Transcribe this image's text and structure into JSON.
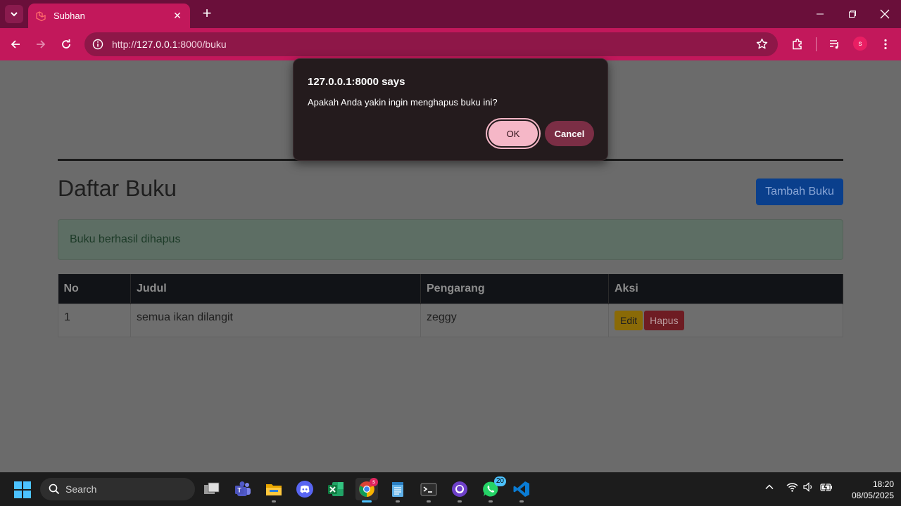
{
  "browser": {
    "tab_title": "Subhan",
    "url_prefix": "http://",
    "url_host": "127.0.0.1",
    "url_suffix": ":8000/buku",
    "profile_initial": "s"
  },
  "page": {
    "title": "Daftar Buku",
    "add_button": "Tambah Buku",
    "alert_message": "Buku berhasil dihapus",
    "table": {
      "headers": [
        "No",
        "Judul",
        "Pengarang",
        "Aksi"
      ],
      "rows": [
        {
          "no": "1",
          "judul": "semua ikan dilangit",
          "pengarang": "zeggy",
          "edit": "Edit",
          "hapus": "Hapus"
        }
      ]
    }
  },
  "dialog": {
    "title": "127.0.0.1:8000 says",
    "message": "Apakah Anda yakin ingin menghapus buku ini?",
    "ok_label": "OK",
    "cancel_label": "Cancel"
  },
  "taskbar": {
    "search_placeholder": "Search",
    "chrome_badge": "s",
    "whatsapp_badge": "20",
    "time": "18:20",
    "date": "08/05/2025"
  }
}
